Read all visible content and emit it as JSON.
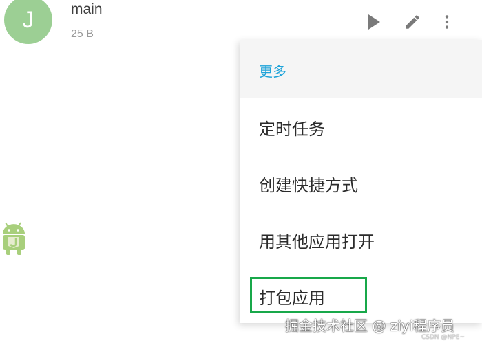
{
  "file": {
    "avatar_letter": "J",
    "name": "main",
    "size": "25 B"
  },
  "actions": {
    "play_icon": "play-icon",
    "edit_icon": "pencil-icon",
    "more_icon": "more-vert-icon"
  },
  "menu": {
    "header": "更多",
    "items": [
      {
        "label": "定时任务"
      },
      {
        "label": "创建快捷方式"
      },
      {
        "label": "用其他应用打开"
      },
      {
        "label": "打包应用"
      }
    ],
    "highlighted_item": 3
  },
  "watermark": {
    "text": "掘金技术社区 @ ziyi程序员",
    "small_text": "CSDN @NPE~"
  },
  "colors": {
    "avatar": "#9ccf94",
    "accent": "#1ea3d9",
    "highlight": "#18a84a",
    "icon": "#7a7a7a"
  }
}
